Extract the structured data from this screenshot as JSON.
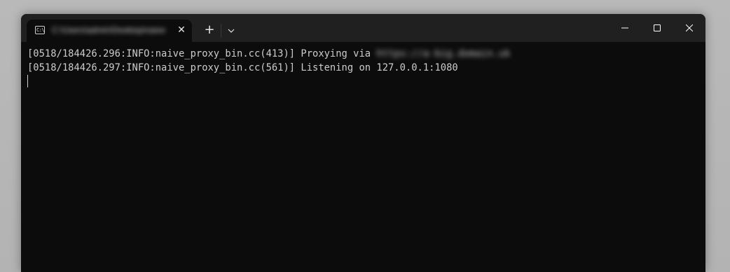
{
  "tab": {
    "title": "C:\\Users\\admin\\Desktop\\naive",
    "icon": "terminal-icon",
    "icon_glyph": "C:\\",
    "close_glyph": "✕"
  },
  "tabbar": {
    "new_tab_glyph": "+",
    "dropdown_icon": "chevron-down-icon"
  },
  "window_controls": {
    "minimize_icon": "minimize-icon",
    "maximize_icon": "maximize-icon",
    "close_icon": "close-icon"
  },
  "terminal": {
    "lines": [
      {
        "prefix": "[0518/184426.296:INFO:naive_proxy_bin.cc(413)] Proxying via ",
        "redacted": "https://a-big.domain.uk"
      },
      {
        "prefix": "[0518/184426.297:INFO:naive_proxy_bin.cc(561)] Listening on 127.0.0.1:1080"
      }
    ]
  },
  "colors": {
    "terminal_bg": "#0c0c0c",
    "titlebar_bg": "#202020",
    "text": "#cccccc"
  }
}
